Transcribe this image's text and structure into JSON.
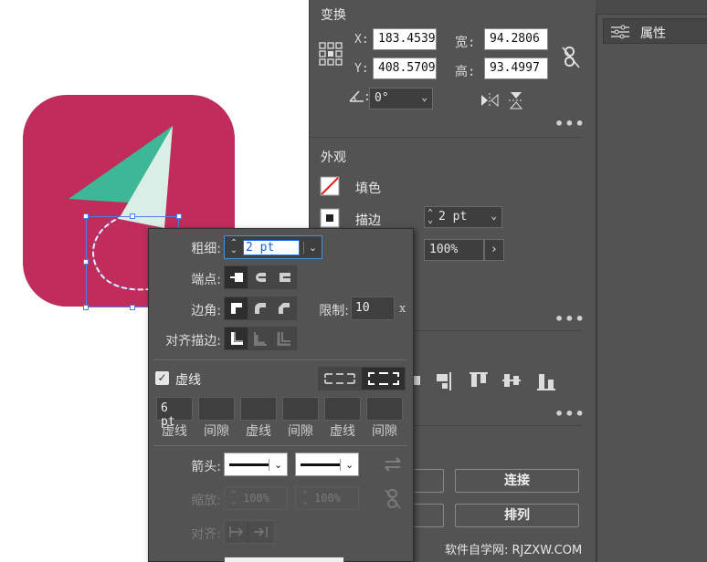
{
  "transform": {
    "title": "变换",
    "x_label": "X:",
    "x_value": "183.4539",
    "y_label": "Y:",
    "y_value": "408.5709",
    "w_label": "宽:",
    "w_value": "94.2806",
    "h_label": "高:",
    "h_value": "93.4997",
    "angle_value": "0°"
  },
  "appearance": {
    "title": "外观",
    "fill_label": "填色",
    "stroke_label": "描边",
    "stroke_value": "2 pt",
    "opacity_value": "100%"
  },
  "right_panel": {
    "tab_label": "属性"
  },
  "quick_actions": {
    "connect_label": "连接",
    "arrange_label": "排列"
  },
  "stroke_popup": {
    "weight_label": "粗细:",
    "weight_value": "2 pt",
    "cap_label": "端点:",
    "corner_label": "边角:",
    "limit_label": "限制:",
    "limit_value": "10",
    "limit_unit": "x",
    "align_label": "对齐描边:",
    "dashed_label": "虚线",
    "dashed_checked": true,
    "dash_values": [
      "6 pt",
      "",
      "",
      "",
      "",
      ""
    ],
    "dash_captions": [
      "虚线",
      "间隙",
      "虚线",
      "间隙",
      "虚线",
      "间隙"
    ],
    "arrow_label": "箭头:",
    "scale_label": "缩放:",
    "scale_start": "100%",
    "scale_end": "100%",
    "align_arrow_label": "对齐:"
  },
  "watermark": "软件自学网: RJZXW.COM",
  "colors": {
    "icon_bg": "#c02d5a",
    "green": "#3db795",
    "light_green": "#d9eee7",
    "panel": "#535353",
    "selection": "#4a7cf7"
  }
}
